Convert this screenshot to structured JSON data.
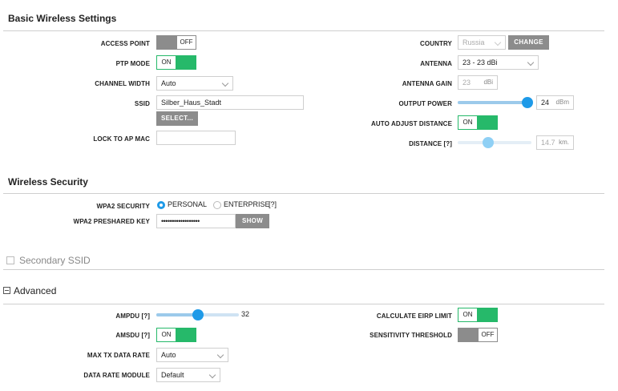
{
  "basic_wireless": {
    "title": "Basic Wireless Settings",
    "access_point": {
      "label": "ACCESS POINT",
      "state": "OFF"
    },
    "ptp_mode": {
      "label": "PTP MODE",
      "state": "ON"
    },
    "channel_width": {
      "label": "CHANNEL WIDTH",
      "value": "Auto"
    },
    "ssid": {
      "label": "SSID",
      "value": "Silber_Haus_Stadt",
      "select_button": "SELECT..."
    },
    "lock_to_ap_mac": {
      "label": "LOCK TO AP MAC",
      "value": ""
    },
    "country": {
      "label": "COUNTRY",
      "value": "Russia",
      "change_button": "CHANGE"
    },
    "antenna": {
      "label": "ANTENNA",
      "value": "23 - 23 dBi"
    },
    "antenna_gain": {
      "label": "ANTENNA GAIN",
      "value": "23",
      "unit": "dBi"
    },
    "output_power": {
      "label": "OUTPUT POWER",
      "value": "24",
      "unit": "dBm",
      "level": 1.0
    },
    "auto_adjust_distance": {
      "label": "AUTO ADJUST DISTANCE",
      "state": "ON"
    },
    "distance": {
      "label": "DISTANCE [?]",
      "value": "14.7",
      "unit": "km.",
      "level": 0.4
    }
  },
  "wireless_security": {
    "title": "Wireless Security",
    "wpa2_security": {
      "label": "WPA2 SECURITY",
      "options": [
        "PERSONAL",
        "ENTERPRISE"
      ],
      "selected": "PERSONAL",
      "help": "[?]"
    },
    "wpa2_preshared_key": {
      "label": "WPA2 PRESHARED KEY",
      "value": "••••••••••••••••••",
      "show_button": "SHOW"
    }
  },
  "secondary_ssid": {
    "label": "Secondary SSID",
    "checked": false
  },
  "advanced": {
    "title": "Advanced",
    "ampdu": {
      "label": "AMPDU [?]",
      "value": "32",
      "level": 0.5
    },
    "amsdu": {
      "label": "AMSDU [?]",
      "state": "ON"
    },
    "max_tx_data_rate": {
      "label": "MAX TX DATA RATE",
      "value": "Auto"
    },
    "data_rate_module": {
      "label": "DATA RATE MODULE",
      "value": "Default"
    },
    "calculate_eirp_limit": {
      "label": "CALCULATE EIRP LIMIT",
      "state": "ON"
    },
    "sensitivity_threshold": {
      "label": "SENSITIVITY THRESHOLD",
      "state": "OFF"
    }
  },
  "colors": {
    "toggle_on": "#26b96a",
    "toggle_off": "#8c8c8c",
    "slider": "#1e9ae8",
    "button": "#8c8c8c"
  }
}
